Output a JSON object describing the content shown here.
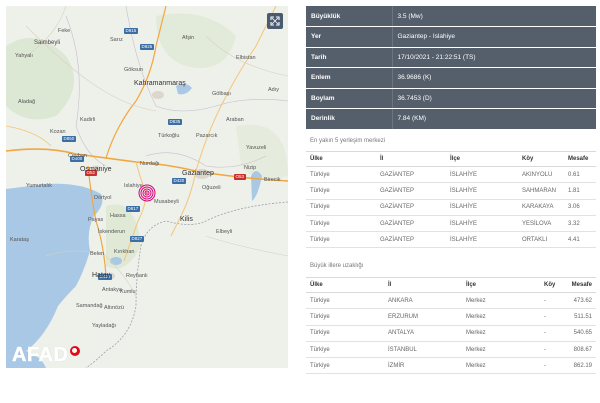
{
  "map": {
    "fullscreen_icon": "expand-icon",
    "logo_text": "AFAD",
    "labels": {
      "kozan": "Kozan",
      "maras": "Kahramanmaraş",
      "gaziantep": "Gaziantep",
      "osmaniye": "Osmaniye",
      "islahiye": "Islahiye",
      "nurdagi": "Nurdağı",
      "hassa": "Hassa",
      "kilis": "Kilis",
      "hatay": "Hatay",
      "reyhanli": "Reyhanlı",
      "musabeyli": "Musabeyli",
      "birecik": "Birecik",
      "nizip": "Nizip",
      "oguzeli": "Oğuzeli",
      "goksun": "Göksun",
      "afsin": "Afşin",
      "pazarcik": "Pazarcık",
      "golbasi": "Gölbaşı",
      "adiyaman": "Adıy",
      "kadirli": "Kadirli",
      "ceyhan": "Ceyhan",
      "iskenderun": "İskenderun",
      "dortyol": "Dörtyol",
      "antakya": "Antakya",
      "samandag": "Samandağ",
      "aladag": "Aladağ",
      "sarkisla": "Saimbeyli",
      "feke": "Feke",
      "tufanbeyli": "Tufanbeyli",
      "yahyali": "Yahyalı",
      "sariz": "Sarız",
      "elbistan": "Elbistan",
      "narli": "Narlı",
      "turkoglu": "Türkoğlu",
      "yavuzeli": "Yavuzeli",
      "araban": "Araban",
      "elbeyli": "Elbeyli",
      "kirikhan": "Kırıkhan",
      "kumlu": "Kumlu",
      "erzin": "Erzin",
      "karatas": "Karataş",
      "yumurtalik": "Yumurtalık",
      "belen": "Belen",
      "altinozu": "Altınözü",
      "yayladagi": "Yayladağı",
      "payas": "Payas",
      "kalkim": "Kalkım"
    },
    "shields": [
      "D815",
      "D825",
      "D835",
      "D850",
      "D400",
      "O52",
      "D817",
      "D827",
      "O53",
      "D420",
      "D410"
    ]
  },
  "info": {
    "rows": [
      {
        "key": "Büyüklük",
        "value": "3.5 (Mw)"
      },
      {
        "key": "Yer",
        "value": "Gaziantep - Islahiye"
      },
      {
        "key": "Tarih",
        "value": "17/10/2021 - 21:22:51 (TS)"
      },
      {
        "key": "Enlem",
        "value": "36.9686 (K)"
      },
      {
        "key": "Boylam",
        "value": "36.7453 (D)"
      },
      {
        "key": "Derinlik",
        "value": "7.84 (KM)"
      }
    ]
  },
  "nearest": {
    "title": "En yakın 5 yerleşim merkezi",
    "headers": [
      "Ülke",
      "İl",
      "İlçe",
      "Köy",
      "Mesafe"
    ],
    "rows": [
      [
        "Türkiye",
        "GAZİANTEP",
        "İSLAHİYE",
        "AKINYOLU",
        "0.61"
      ],
      [
        "Türkiye",
        "GAZİANTEP",
        "İSLAHİYE",
        "SAHMARAN",
        "1.81"
      ],
      [
        "Türkiye",
        "GAZİANTEP",
        "İSLAHİYE",
        "KARAKAYA",
        "3.06"
      ],
      [
        "Türkiye",
        "GAZİANTEP",
        "İSLAHİYE",
        "YESİLOVA",
        "3.32"
      ],
      [
        "Türkiye",
        "GAZİANTEP",
        "İSLAHİYE",
        "ORTAKLI",
        "4.41"
      ]
    ]
  },
  "cities": {
    "title": "Büyük illere uzaklığı",
    "headers": [
      "Ülke",
      "İl",
      "İlçe",
      "Köy",
      "Mesafe"
    ],
    "rows": [
      [
        "Türkiye",
        "ANKARA",
        "Merkez",
        "-",
        "473.62"
      ],
      [
        "Türkiye",
        "ERZURUM",
        "Merkez",
        "-",
        "511.51"
      ],
      [
        "Türkiye",
        "ANTALYA",
        "Merkez",
        "-",
        "540.65"
      ],
      [
        "Türkiye",
        "İSTANBUL",
        "Merkez",
        "-",
        "808.67"
      ],
      [
        "Türkiye",
        "İZMİR",
        "Merkez",
        "-",
        "862.19"
      ]
    ]
  },
  "colors": {
    "info_bg": "#555e6b",
    "epicenter": "#d6007a",
    "sea": "#a9c8e6",
    "land": "#eef0ea"
  }
}
